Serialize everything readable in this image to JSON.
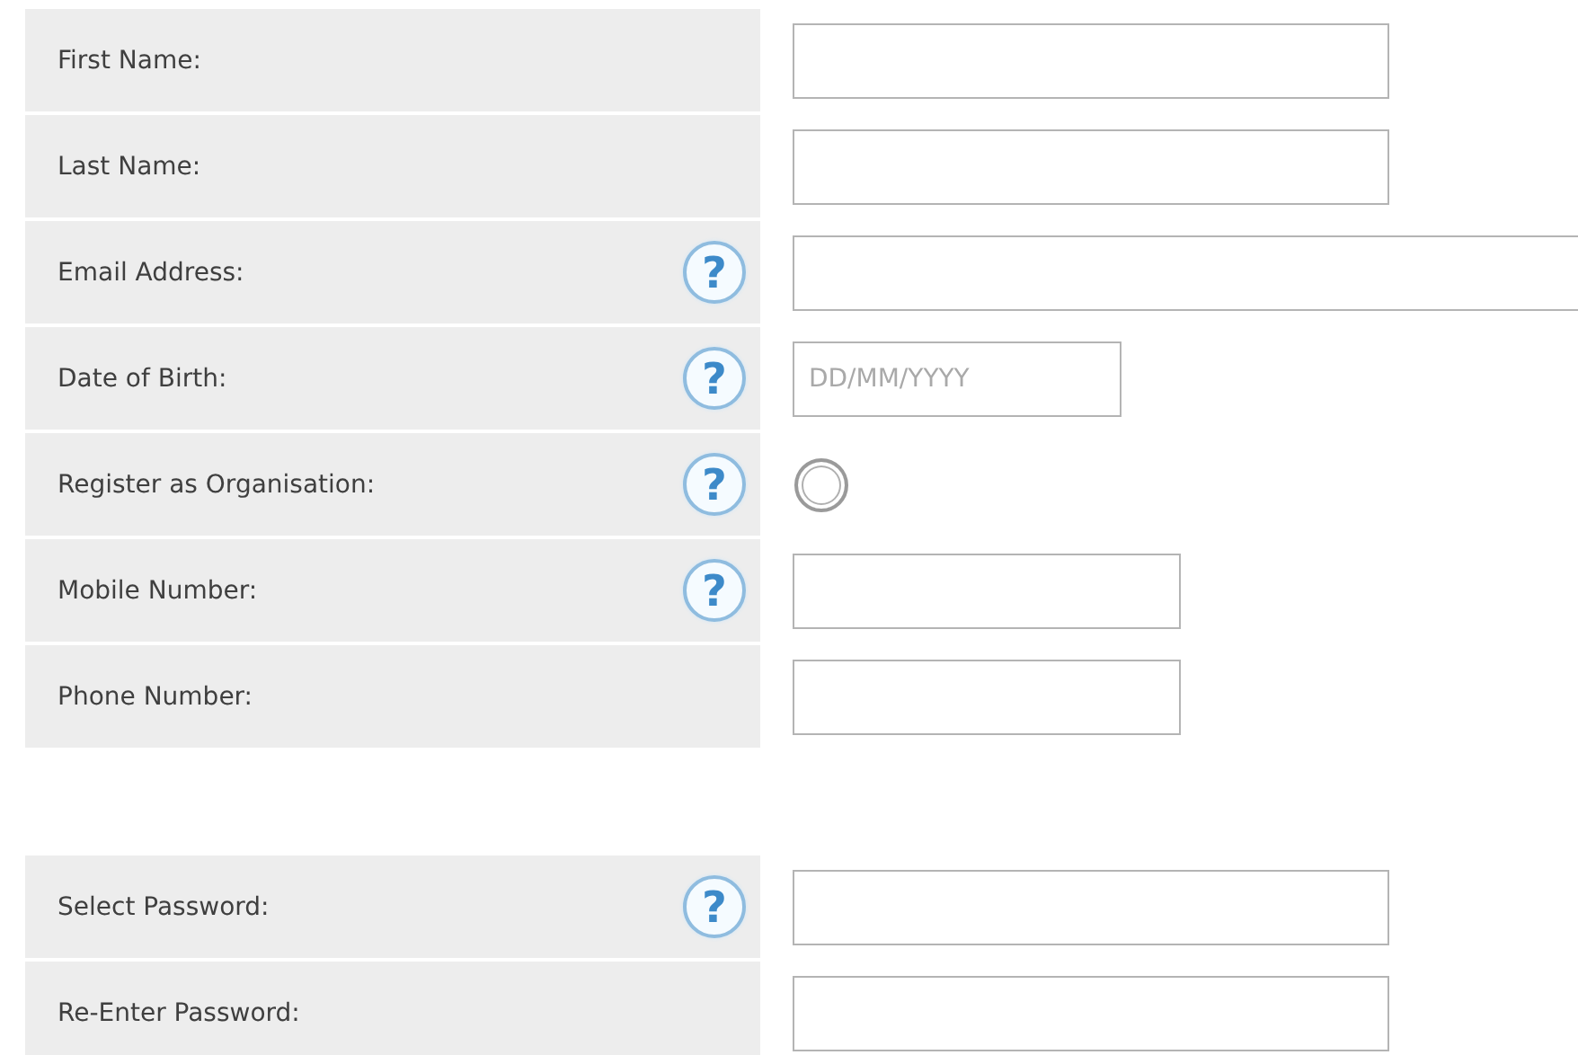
{
  "sections": [
    {
      "rows": [
        {
          "label": "First Name:",
          "field": {
            "kind": "text"
          }
        },
        {
          "label": "Last Name:",
          "field": {
            "kind": "text"
          }
        },
        {
          "label": "Email Address:",
          "help": "?",
          "field": {
            "kind": "email"
          }
        },
        {
          "label": "Date of Birth:",
          "help": "?",
          "field": {
            "kind": "date",
            "placeholder": "DD/MM/YYYY"
          }
        },
        {
          "label": "Register as Organisation:",
          "help": "?",
          "field": {
            "kind": "radio",
            "checked": false
          }
        },
        {
          "label": "Mobile Number:",
          "help": "?",
          "field": {
            "kind": "tel"
          }
        },
        {
          "label": "Phone Number:",
          "field": {
            "kind": "tel"
          }
        }
      ]
    },
    {
      "rows": [
        {
          "label": "Select Password:",
          "help": "?",
          "field": {
            "kind": "password"
          }
        },
        {
          "label": "Re-Enter Password:",
          "field": {
            "kind": "password"
          }
        }
      ]
    }
  ]
}
